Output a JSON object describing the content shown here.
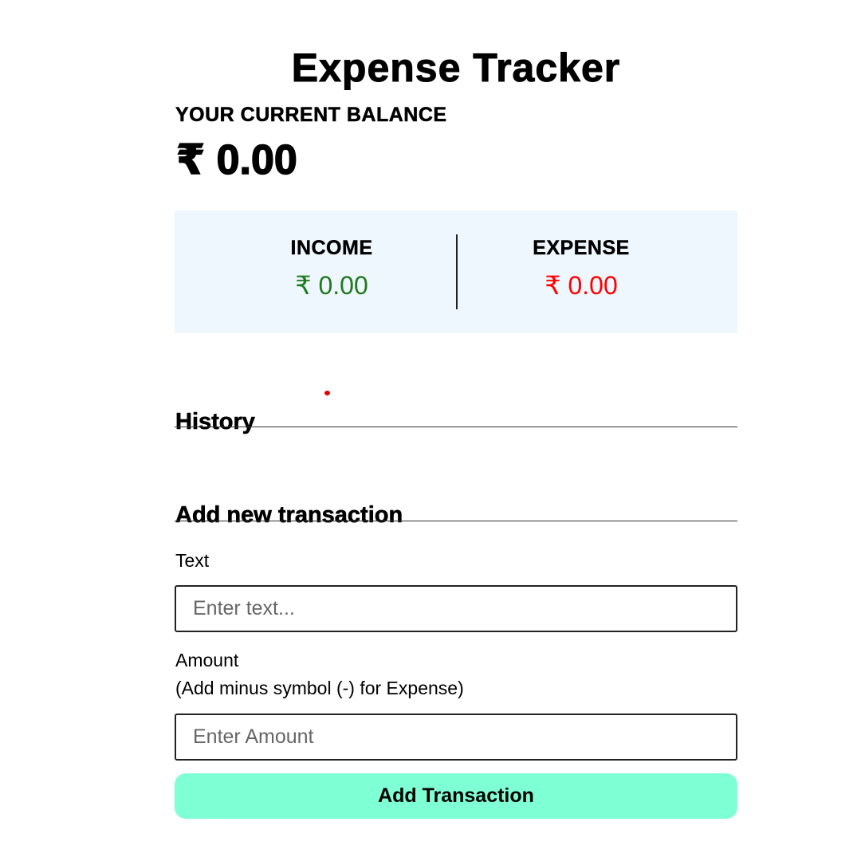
{
  "app": {
    "title": "Expense Tracker"
  },
  "balance": {
    "label": "YOUR CURRENT BALANCE",
    "value": "₹ 0.00"
  },
  "summary": {
    "income_label": "INCOME",
    "income_value": "₹ 0.00",
    "expense_label": "EXPENSE",
    "expense_value": "₹ 0.00"
  },
  "history": {
    "heading": "History"
  },
  "add_transaction": {
    "heading": "Add new transaction",
    "text_label": "Text",
    "text_placeholder": "Enter text...",
    "text_value": "",
    "amount_label_line1": "Amount",
    "amount_label_line2": "(Add minus symbol (-) for Expense)",
    "amount_placeholder": "Enter Amount",
    "amount_value": "",
    "submit_label": "Add Transaction"
  },
  "colors": {
    "income": "#1f7a1f",
    "expense": "#ff0000",
    "summary_background": "#eff7fe",
    "button_background": "#7fffd4"
  }
}
